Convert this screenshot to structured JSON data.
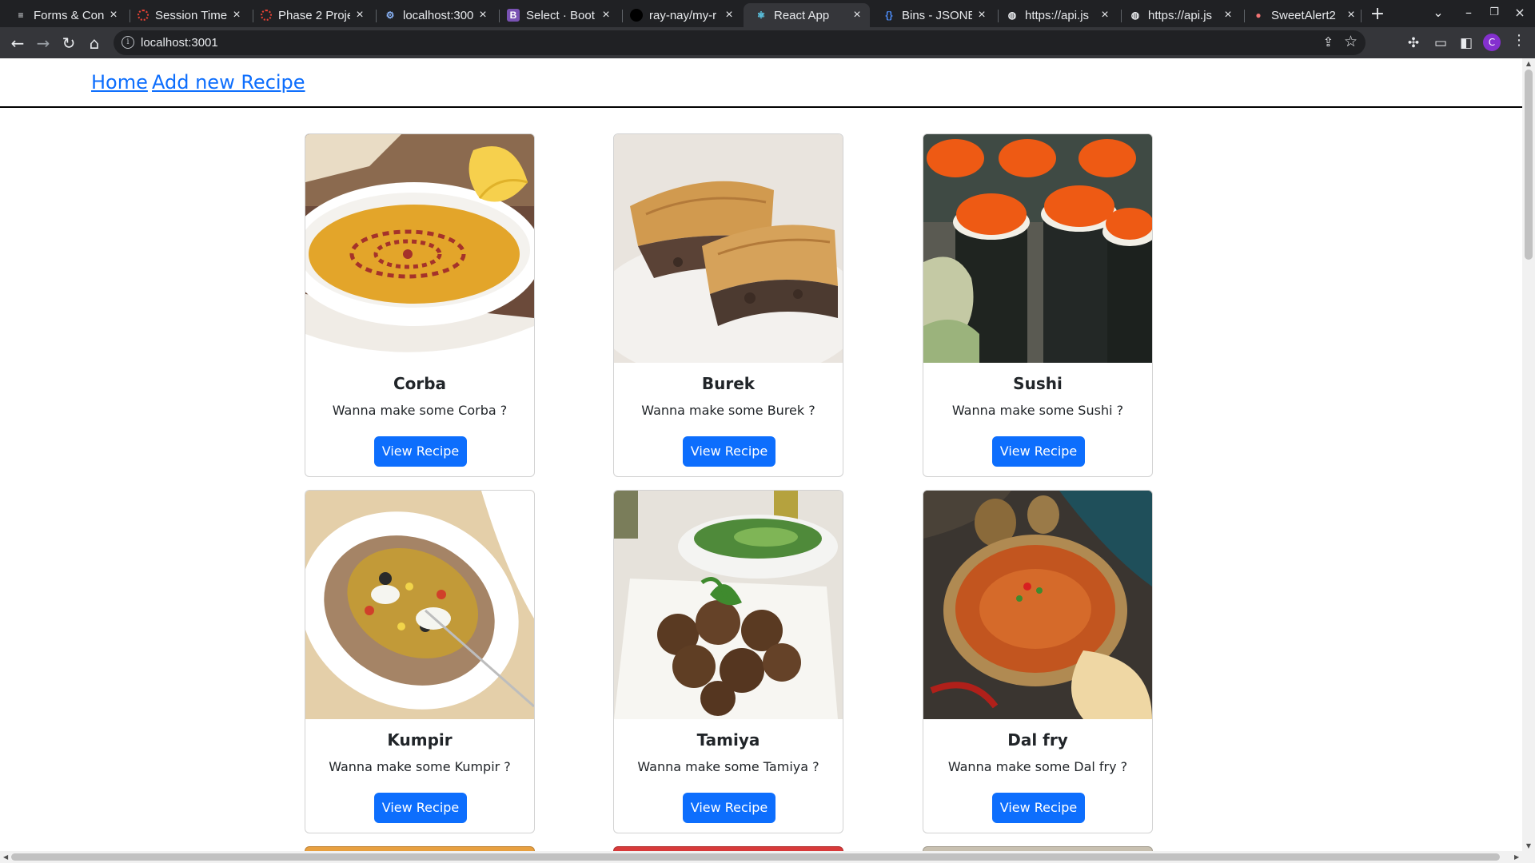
{
  "browser": {
    "tabs": [
      {
        "label": "Forms & Con",
        "icon": "forms-icon"
      },
      {
        "label": "Session Time",
        "icon": "session-icon"
      },
      {
        "label": "Phase 2 Proje",
        "icon": "phase-icon"
      },
      {
        "label": "localhost:300",
        "icon": "localhost-icon"
      },
      {
        "label": "Select · Boot",
        "icon": "bootstrap-icon"
      },
      {
        "label": "ray-nay/my-r",
        "icon": "github-icon"
      },
      {
        "label": "React App",
        "icon": "react-icon",
        "active": true
      },
      {
        "label": "Bins - JSONB",
        "icon": "jsonbin-icon"
      },
      {
        "label": "https://api.js",
        "icon": "globe-icon"
      },
      {
        "label": "https://api.js",
        "icon": "globe-icon"
      },
      {
        "label": "SweetAlert2",
        "icon": "sweetalert-icon"
      }
    ],
    "url": "localhost:3001",
    "profile_initial": "C"
  },
  "nav": {
    "home": "Home",
    "add_recipe": "Add new Recipe"
  },
  "recipes": [
    {
      "title": "Corba",
      "text": "Wanna make some Corba ?",
      "button": "View Recipe"
    },
    {
      "title": "Burek",
      "text": "Wanna make some Burek ?",
      "button": "View Recipe"
    },
    {
      "title": "Sushi",
      "text": "Wanna make some Sushi ?",
      "button": "View Recipe"
    },
    {
      "title": "Kumpir",
      "text": "Wanna make some Kumpir ?",
      "button": "View Recipe"
    },
    {
      "title": "Tamiya",
      "text": "Wanna make some Tamiya ?",
      "button": "View Recipe"
    },
    {
      "title": "Dal fry",
      "text": "Wanna make some Dal fry ?",
      "button": "View Recipe"
    }
  ],
  "colors": {
    "accent": "#0d6efd",
    "link": "#0d6efd",
    "chrome_dark": "#202124",
    "chrome_toolbar": "#35363a"
  }
}
